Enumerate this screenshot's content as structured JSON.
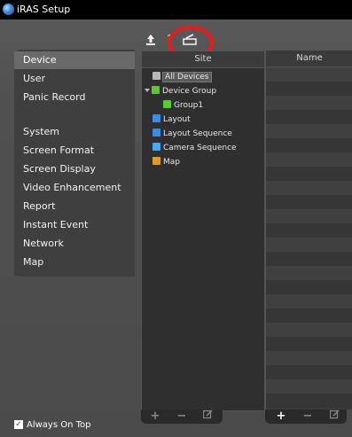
{
  "window": {
    "title": "iRAS Setup"
  },
  "sidebar": {
    "items": [
      {
        "label": "Device",
        "selected": true
      },
      {
        "label": "User",
        "selected": false
      },
      {
        "label": "Panic Record",
        "selected": false
      },
      {
        "label": "System",
        "selected": false
      },
      {
        "label": "Screen Format",
        "selected": false
      },
      {
        "label": "Screen Display",
        "selected": false
      },
      {
        "label": "Video Enhancement",
        "selected": false
      },
      {
        "label": "Report",
        "selected": false
      },
      {
        "label": "Instant Event",
        "selected": false
      },
      {
        "label": "Network",
        "selected": false
      },
      {
        "label": "Map",
        "selected": false
      }
    ]
  },
  "options": {
    "always_on_top_label": "Always On Top",
    "always_on_top_checked": true
  },
  "toolbar": {
    "icons": [
      "upload-icon",
      "help-icon",
      "edit-device-icon"
    ]
  },
  "tree": {
    "header": "Site",
    "items": [
      {
        "label": "All Devices",
        "icon": "all-devices-icon",
        "color": "#b8b8b8",
        "selected": true
      },
      {
        "label": "Device Group",
        "icon": "device-group-icon",
        "color": "#55cc33",
        "expanded": true
      },
      {
        "label": "Group1",
        "icon": "group-icon",
        "color": "#55cc33"
      },
      {
        "label": "Layout",
        "icon": "layout-icon",
        "color": "#3a8de0"
      },
      {
        "label": "Layout Sequence",
        "icon": "layout-sequence-icon",
        "color": "#3a8de0"
      },
      {
        "label": "Camera Sequence",
        "icon": "camera-sequence-icon",
        "color": "#4aa8f0"
      },
      {
        "label": "Map",
        "icon": "map-icon",
        "color": "#e09a2a"
      }
    ],
    "footer_icons": [
      "add-icon",
      "remove-icon",
      "edit-icon"
    ]
  },
  "name_list": {
    "header": "Name",
    "footer_icons": [
      "add-icon",
      "remove-icon",
      "edit-icon"
    ]
  },
  "colors": {
    "highlight": "#ee1a1a",
    "selected_item": "#6a6a6a"
  }
}
